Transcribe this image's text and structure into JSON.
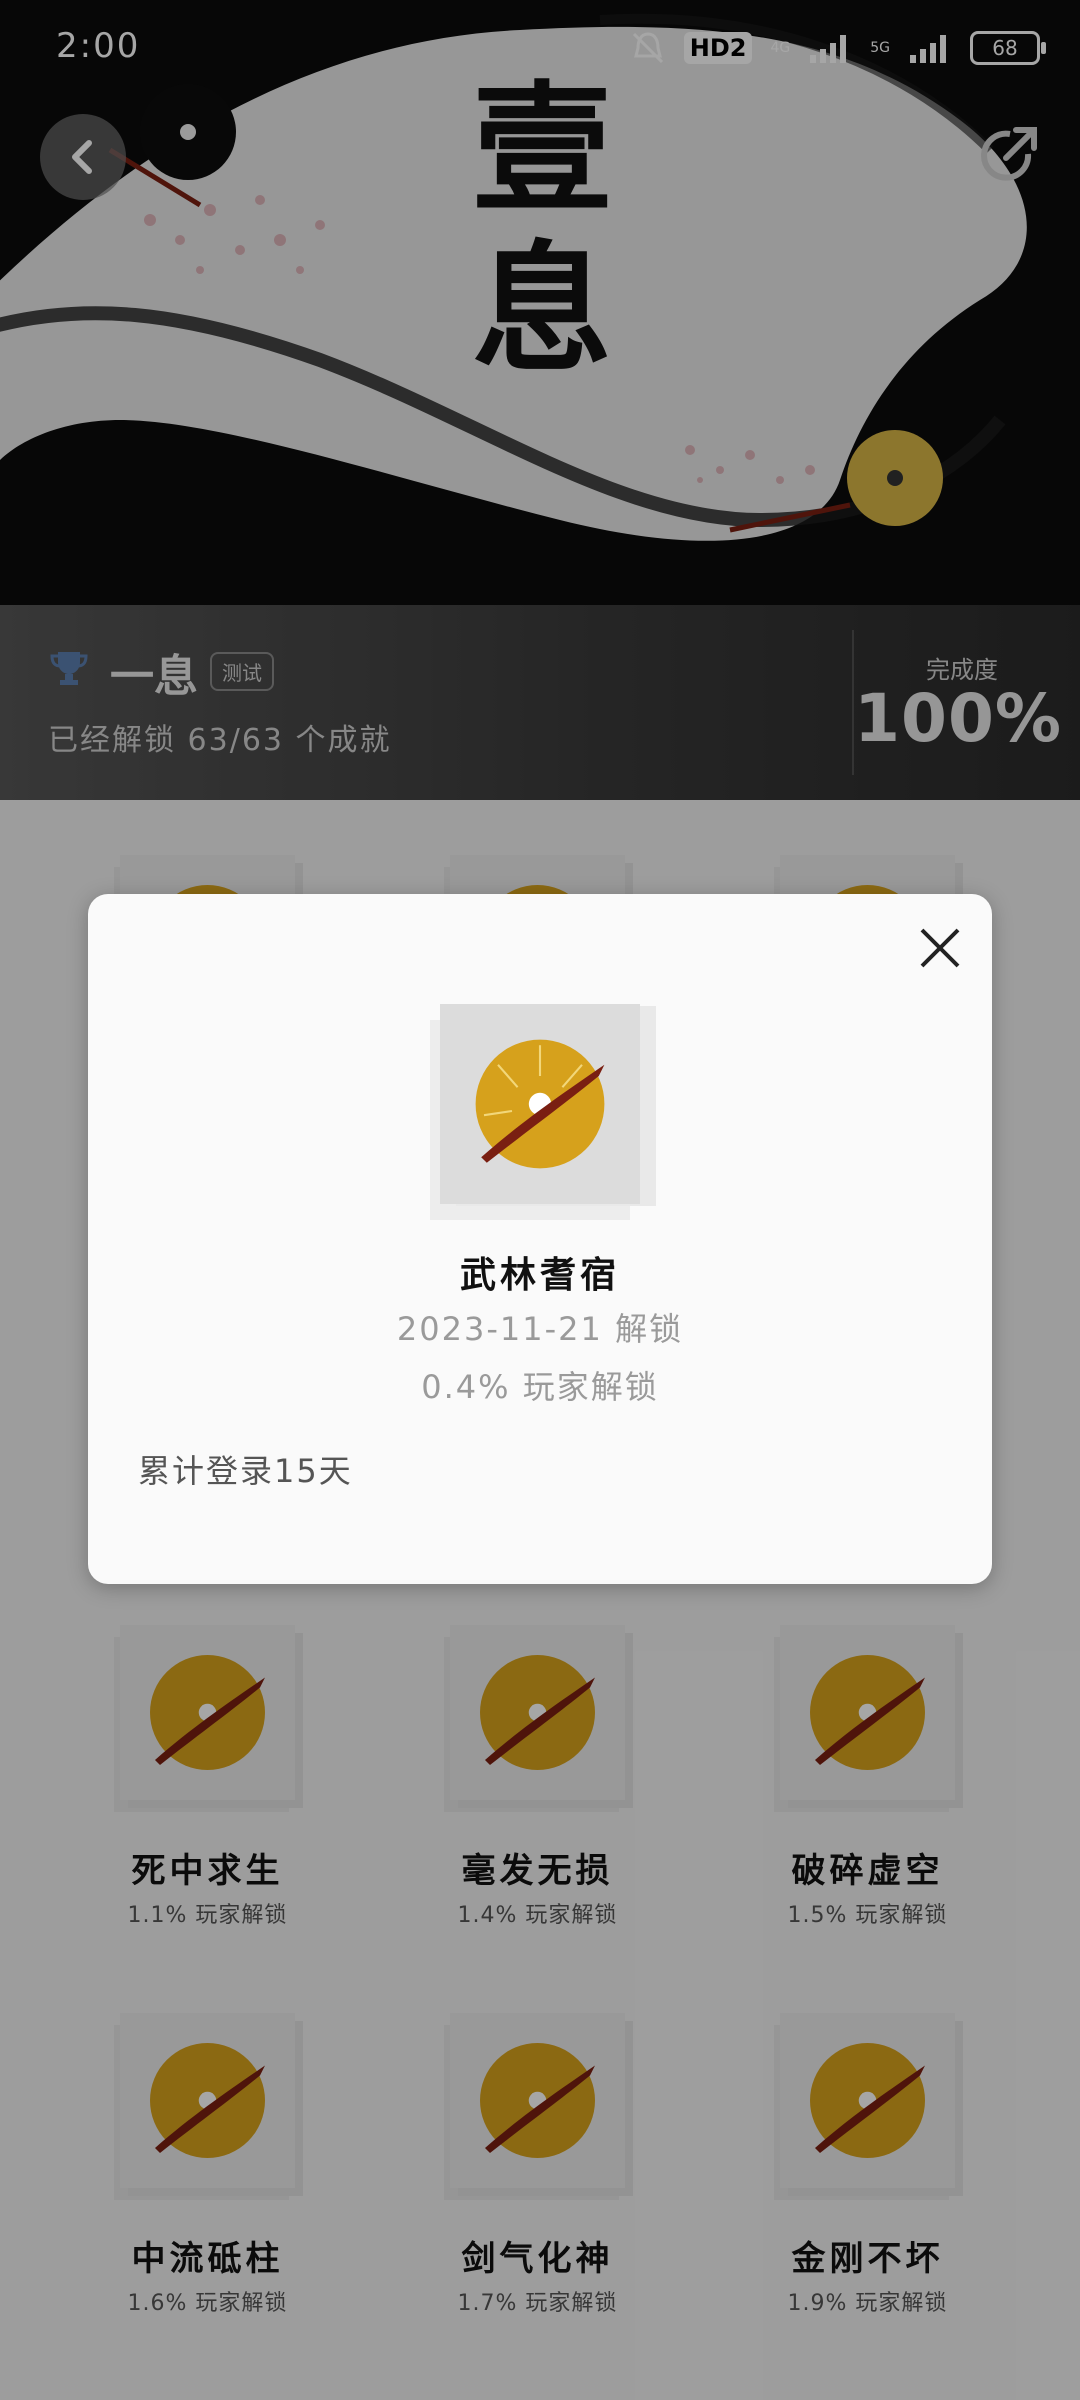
{
  "status_bar": {
    "time": "2:00",
    "hd_label": "HD2",
    "net1": "4G",
    "net2": "5G",
    "battery": "68"
  },
  "hero": {
    "title_line1": "壹",
    "title_line2": "息"
  },
  "stats": {
    "game_title": "一息",
    "badge": "测试",
    "unlock_summary": "已经解锁 63/63 个成就",
    "completion_label": "完成度",
    "completion_value": "100%"
  },
  "achievements": [
    {
      "name": "死中求生",
      "rate": "1.1% 玩家解锁"
    },
    {
      "name": "毫发无损",
      "rate": "1.4% 玩家解锁"
    },
    {
      "name": "破碎虚空",
      "rate": "1.5% 玩家解锁"
    },
    {
      "name": "中流砥柱",
      "rate": "1.6% 玩家解锁"
    },
    {
      "name": "剑气化神",
      "rate": "1.7% 玩家解锁"
    },
    {
      "name": "金刚不坏",
      "rate": "1.9% 玩家解锁"
    }
  ],
  "modal": {
    "name": "武林耆宿",
    "unlock_date": "2023-11-21 解锁",
    "player_rate": "0.4% 玩家解锁",
    "condition": "累计登录15天"
  },
  "colors": {
    "coin_gold": "#d6a11c",
    "slash_red": "#7a1f12",
    "overlay": "#000000"
  }
}
